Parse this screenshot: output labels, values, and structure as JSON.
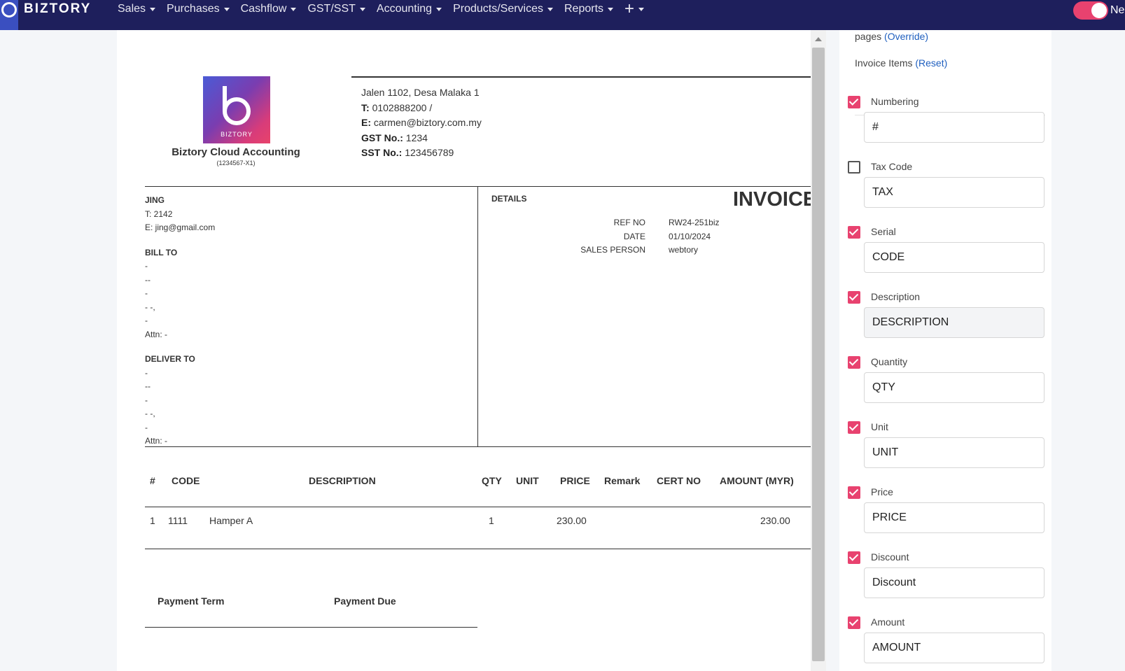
{
  "nav": {
    "brand": "BIZTORY",
    "items": [
      {
        "label": "Sales"
      },
      {
        "label": "Purchases"
      },
      {
        "label": "Cashflow"
      },
      {
        "label": "GST/SST"
      },
      {
        "label": "Accounting"
      },
      {
        "label": "Products/Services"
      },
      {
        "label": "Reports"
      }
    ],
    "plus_symbol": "+",
    "new_label": "Ne",
    "accent_color": "#e8426f",
    "bg_color": "#1e1f5c"
  },
  "invoice": {
    "company_name": "Biztory Cloud Accounting",
    "company_reg": "(1234567-X1)",
    "logo_text": "BIZTORY",
    "address": "Jalen 1102, Desa Malaka 1",
    "phone_label": "T:",
    "phone": "0102888200 /",
    "email_label": "E:",
    "email": "carmen@biztory.com.my",
    "gst_label": "GST No.:",
    "gst": "1234",
    "sst_label": "SST No.:",
    "sst": "123456789",
    "customer": {
      "name": "JING",
      "phone": "T: 2142",
      "email": "E: jing@gmail.com"
    },
    "bill_to": {
      "heading": "BILL TO",
      "lines": [
        "-",
        "--",
        "-",
        "- -,",
        "-"
      ],
      "attn": "Attn: -"
    },
    "deliver_to": {
      "heading": "DELIVER TO",
      "lines": [
        "-",
        "--",
        "-",
        "- -,",
        "-"
      ],
      "attn": "Attn: -"
    },
    "details_heading": "DETAILS",
    "title": "INVOICE",
    "details": [
      {
        "key": "REF NO",
        "value": "RW24-251biz"
      },
      {
        "key": "DATE",
        "value": "01/10/2024"
      },
      {
        "key": "SALES PERSON",
        "value": "webtory"
      }
    ],
    "table": {
      "headers": [
        "#",
        "CODE",
        "DESCRIPTION",
        "QTY",
        "UNIT",
        "PRICE",
        "Remark",
        "CERT NO",
        "AMOUNT (MYR)"
      ],
      "rows": [
        {
          "no": "1",
          "code": "1111",
          "desc": "Hamper A",
          "qty": "1",
          "unit": "",
          "price": "230.00",
          "remark": "",
          "cert": "",
          "amount": "230.00"
        }
      ]
    },
    "payment_term": "Payment Term",
    "payment_due": "Payment Due"
  },
  "panel": {
    "pages_label": "pages",
    "override_link": "(Override)",
    "items_label": "Invoice Items",
    "reset_link": "(Reset)",
    "fields": [
      {
        "label": "Numbering",
        "value": "#",
        "checked": true
      },
      {
        "label": "Tax Code",
        "value": "TAX",
        "checked": false
      },
      {
        "label": "Serial",
        "value": "CODE",
        "checked": true
      },
      {
        "label": "Description",
        "value": "DESCRIPTION",
        "checked": true
      },
      {
        "label": "Quantity",
        "value": "QTY",
        "checked": true
      },
      {
        "label": "Unit",
        "value": "UNIT",
        "checked": true
      },
      {
        "label": "Price",
        "value": "PRICE",
        "checked": true
      },
      {
        "label": "Discount",
        "value": "Discount",
        "checked": true
      },
      {
        "label": "Amount",
        "value": "AMOUNT",
        "checked": true
      }
    ]
  }
}
